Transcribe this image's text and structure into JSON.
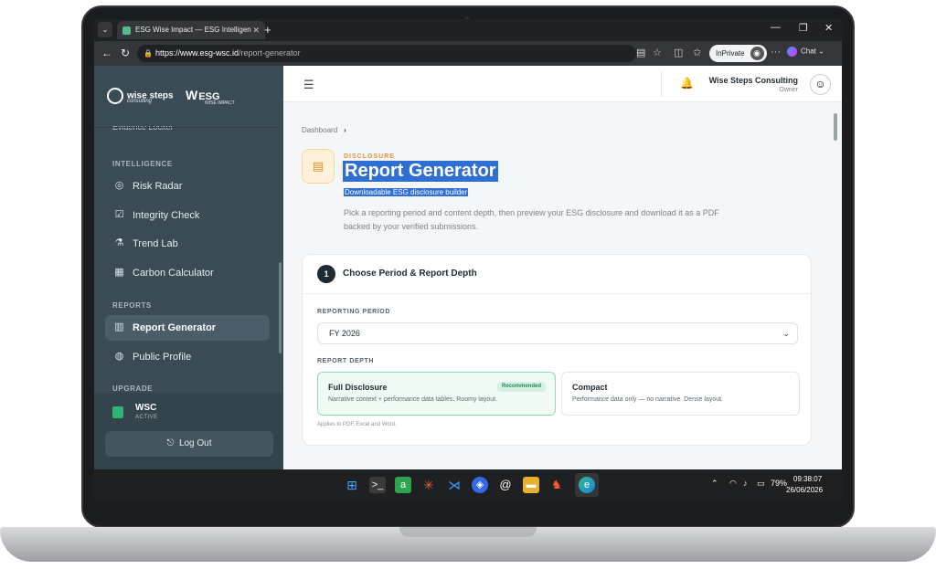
{
  "browser": {
    "tab_title": "ESG Wise Impact — ESG Intelligen",
    "url_host": "https://www.esg-wsc.id",
    "url_path": "/report-generator",
    "inprivate_label": "InPrivate",
    "chat_label": "Chat"
  },
  "sidebar": {
    "brand_left": "wise steps",
    "brand_left_sub": "consulting",
    "brand_right": "ESG",
    "brand_right_sub": "WISE IMPACT",
    "cut_item": "Evidence Locker",
    "section_intelligence": "INTELLIGENCE",
    "section_reports": "REPORTS",
    "section_upgrade": "UPGRADE",
    "items": [
      {
        "label": "Risk Radar",
        "icon": "radar-icon"
      },
      {
        "label": "Integrity Check",
        "icon": "checklist-icon"
      },
      {
        "label": "Trend Lab",
        "icon": "flask-icon"
      },
      {
        "label": "Carbon Calculator",
        "icon": "calculator-icon"
      },
      {
        "label": "Report Generator",
        "icon": "bar-chart-icon"
      },
      {
        "label": "Public Profile",
        "icon": "globe-icon"
      }
    ],
    "org_name": "WSC",
    "org_status": "ACTIVE",
    "logout_label": "Log Out"
  },
  "header": {
    "user_name": "Wise Steps Consulting",
    "user_role": "Owner"
  },
  "main": {
    "breadcrumb": "Dashboard",
    "eyebrow": "DISCLOSURE",
    "title": "Report Generator",
    "subtitle": "Downloadable ESG disclosure builder",
    "description": "Pick a reporting period and content depth, then preview your ESG disclosure and download it as a PDF backed by your verified submissions.",
    "step": {
      "number": "1",
      "title": "Choose Period & Report Depth",
      "period_label": "REPORTING PERIOD",
      "period_value": "FY 2026",
      "depth_label": "REPORT DEPTH",
      "options": [
        {
          "title": "Full Disclosure",
          "desc": "Narrative context + performance data tables. Roomy layout.",
          "badge": "Recommended"
        },
        {
          "title": "Compact",
          "desc": "Performance data only — no narrative. Dense layout."
        }
      ],
      "note": "Applies to PDF, Excel and Word."
    }
  },
  "taskbar": {
    "battery": "79%",
    "time": "09:38:07",
    "date": "26/06/2026"
  },
  "colors": {
    "sidebar_bg": "#3a4b55",
    "accent_orange": "#e4902f",
    "selection_blue": "#2f6fd4",
    "recommended_green": "#2b8a5a"
  }
}
